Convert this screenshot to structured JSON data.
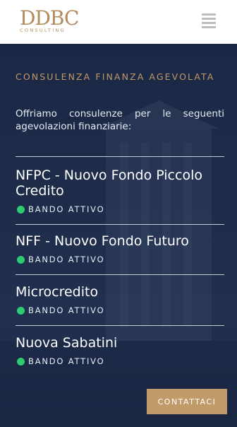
{
  "header": {
    "logo_text": "DDBC",
    "logo_subtext": "CONSULTING",
    "menu_icon": "hamburger-menu-icon"
  },
  "hero": {
    "eyebrow": "CONSULENZA FINANZA AGEVOLATA",
    "intro": "Offriamo consulenze per le seguenti agevolazioni finanziarie:",
    "items": [
      {
        "title": "NFPC - Nuovo Fondo Piccolo Credito",
        "status": "BANDO ATTIVO"
      },
      {
        "title": "NFF - Nuovo Fondo Futuro",
        "status": "BANDO ATTIVO"
      },
      {
        "title": "Microcredito",
        "status": "BANDO ATTIVO"
      },
      {
        "title": "Nuova Sabatini",
        "status": "BANDO ATTIVO"
      }
    ],
    "cta_label": "CONTATTACI"
  },
  "colors": {
    "accent": "#c19a69",
    "background": "#1c2a47",
    "status_active": "#2ecc71"
  }
}
